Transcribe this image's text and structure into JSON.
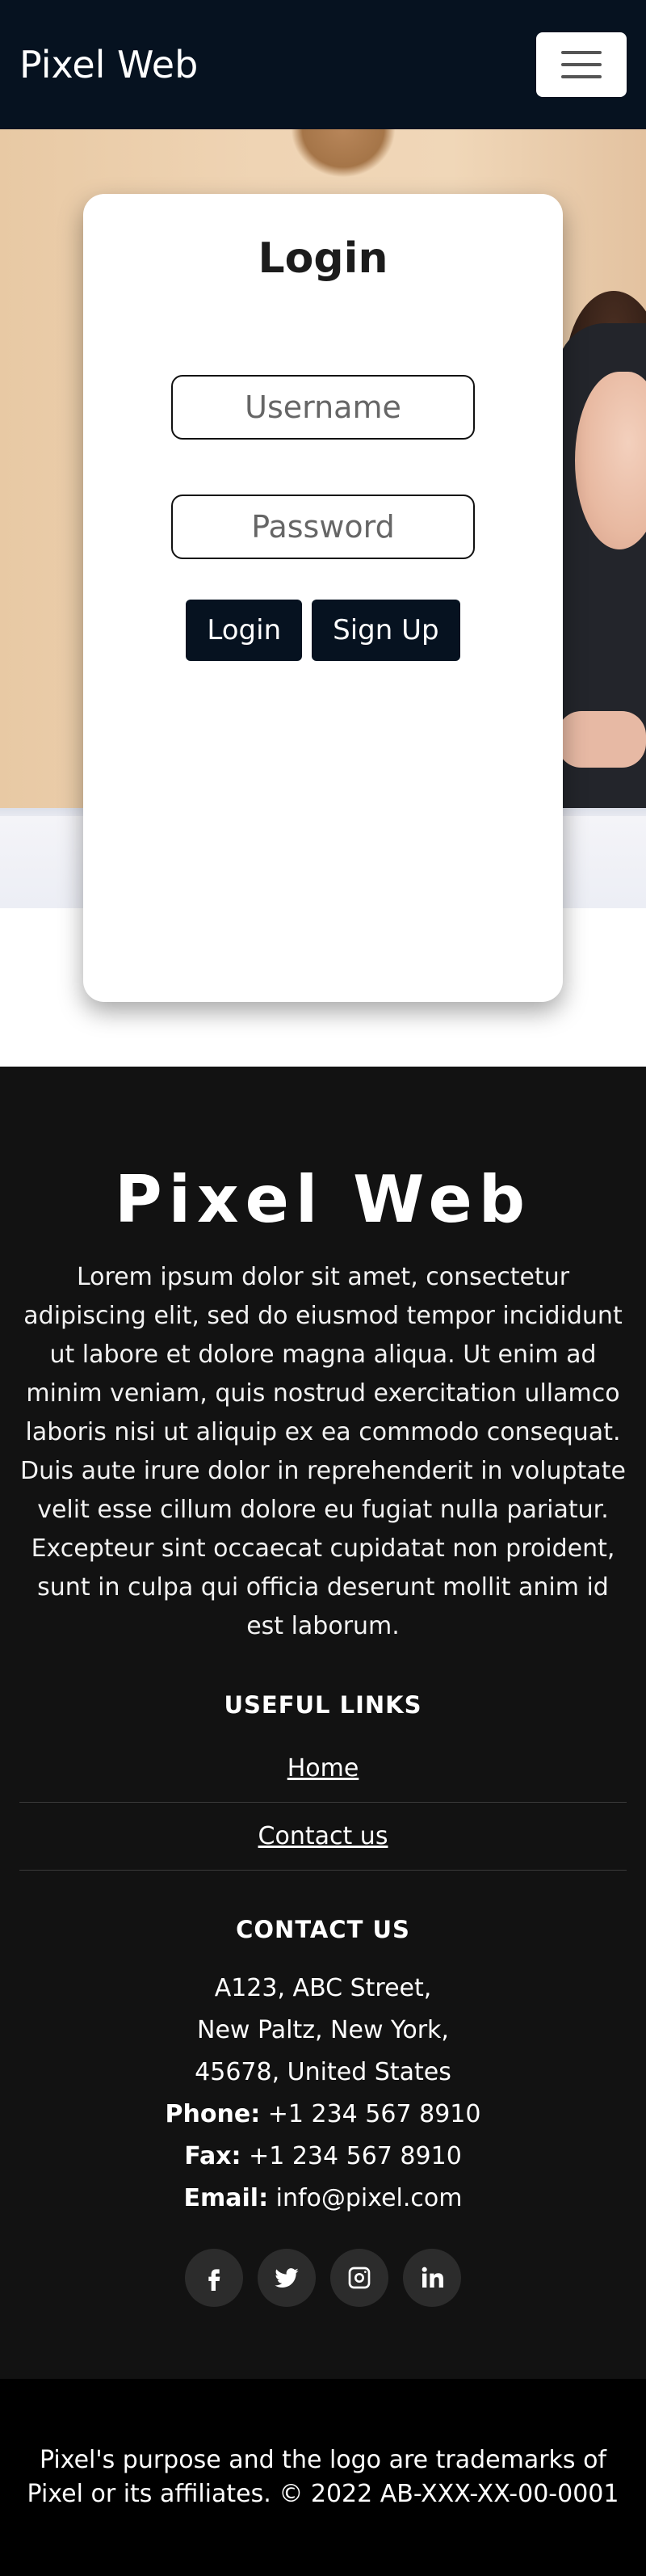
{
  "navbar": {
    "brand": "Pixel Web",
    "toggle_icon": "hamburger-menu-icon"
  },
  "login": {
    "title": "Login",
    "username_placeholder": "Username",
    "password_placeholder": "Password",
    "login_label": "Login",
    "signup_label": "Sign Up"
  },
  "footer": {
    "brand": "Pixel Web",
    "description": "Lorem ipsum dolor sit amet, consectetur adipiscing elit, sed do eiusmod tempor incididunt ut labore et dolore magna aliqua. Ut enim ad minim veniam, quis nostrud exercitation ullamco laboris nisi ut aliquip ex ea commodo consequat. Duis aute irure dolor in reprehenderit in voluptate velit esse cillum dolore eu fugiat nulla pariatur. Excepteur sint occaecat cupidatat non proident, sunt in culpa qui officia deserunt mollit anim id est laborum.",
    "useful_links_title": "USEFUL LINKS",
    "links": [
      {
        "label": "Home"
      },
      {
        "label": "Contact us"
      }
    ],
    "contact_title": "CONTACT US",
    "address_line1": "A123, ABC Street,",
    "address_line2": "New Paltz, New York,",
    "address_line3": "45678, United States",
    "phone_label": "Phone:",
    "phone_value": "+1 234 567 8910",
    "fax_label": "Fax:",
    "fax_value": "+1 234 567 8910",
    "email_label": "Email:",
    "email_value": "info@pixel.com",
    "socials": [
      "facebook-icon",
      "twitter-icon",
      "instagram-icon",
      "linkedin-icon"
    ]
  },
  "bottom": {
    "text": "Pixel's purpose and the logo are trademarks of Pixel or its affiliates. © 2022 AB-XXX-XX-00-0001"
  },
  "colors": {
    "navbar_bg": "#061220",
    "button_bg": "#061220",
    "footer_bg": "#121212",
    "bottom_bg": "#000000"
  }
}
